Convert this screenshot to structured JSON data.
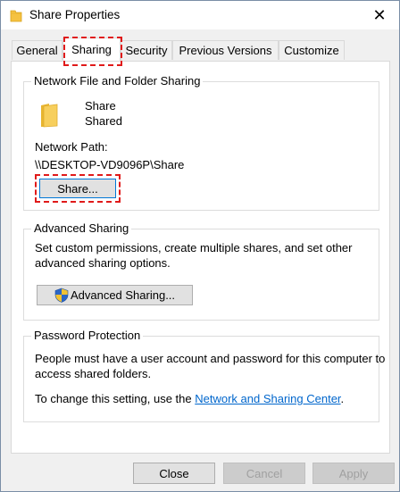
{
  "window": {
    "title": "Share Properties",
    "close_glyph": "✕"
  },
  "tabs": [
    {
      "label": "General"
    },
    {
      "label": "Sharing",
      "active": true
    },
    {
      "label": "Security"
    },
    {
      "label": "Previous Versions"
    },
    {
      "label": "Customize"
    }
  ],
  "network_sharing": {
    "group_title": "Network File and Folder Sharing",
    "folder_name": "Share",
    "folder_status": "Shared",
    "path_label": "Network Path:",
    "path_value": "\\\\DESKTOP-VD9096P\\Share",
    "share_button": "Share..."
  },
  "advanced_sharing": {
    "group_title": "Advanced Sharing",
    "description_line1": "Set custom permissions, create multiple shares, and set other",
    "description_line2": "advanced sharing options.",
    "button": "Advanced Sharing..."
  },
  "password_protection": {
    "group_title": "Password Protection",
    "line1": "People must have a user account and password for this computer to",
    "line2": "access shared folders.",
    "line3_prefix": "To change this setting, use the ",
    "link_text": "Network and Sharing Center",
    "line3_suffix": "."
  },
  "footer": {
    "close": "Close",
    "cancel": "Cancel",
    "apply": "Apply"
  },
  "colors": {
    "highlight": "#e01a1a",
    "link": "#0066cc",
    "folder": "#f5c242"
  }
}
